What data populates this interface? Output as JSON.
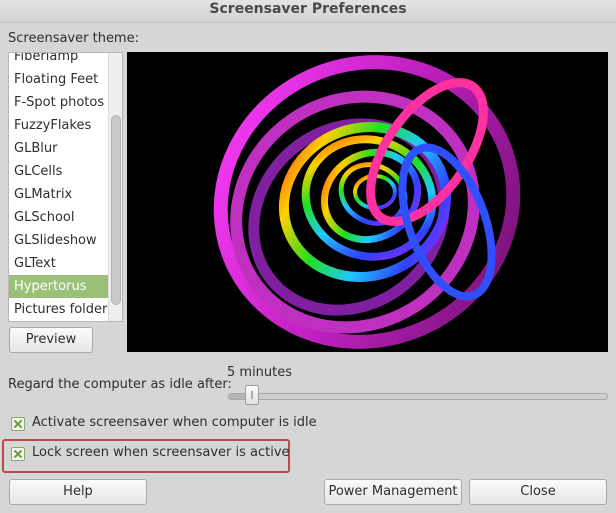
{
  "window": {
    "title": "Screensaver Preferences"
  },
  "theme": {
    "label": "Screensaver theme:",
    "items": [
      {
        "label": "Fiberlamp",
        "selected": false
      },
      {
        "label": "Floating Feet",
        "selected": false
      },
      {
        "label": "F-Spot photos",
        "selected": false
      },
      {
        "label": "FuzzyFlakes",
        "selected": false
      },
      {
        "label": "GLBlur",
        "selected": false
      },
      {
        "label": "GLCells",
        "selected": false
      },
      {
        "label": "GLMatrix",
        "selected": false
      },
      {
        "label": "GLSchool",
        "selected": false
      },
      {
        "label": "GLSlideshow",
        "selected": false
      },
      {
        "label": "GLText",
        "selected": false
      },
      {
        "label": "Hypertorus",
        "selected": true
      },
      {
        "label": "Pictures folder",
        "selected": false
      }
    ],
    "preview_button": "Preview"
  },
  "idle": {
    "label": "Regard the computer as idle after:",
    "value_text": "5 minutes",
    "slider_fraction": 0.06
  },
  "options": {
    "activate": {
      "label": "Activate screensaver when computer is idle",
      "checked": true
    },
    "lock": {
      "label": "Lock screen when screensaver is active",
      "checked": true
    }
  },
  "buttons": {
    "help": "Help",
    "power": "Power Management",
    "close": "Close"
  },
  "colors": {
    "selection": "#9cc07a",
    "highlight_border": "#c0474b",
    "checkbox_check": "#6d9a3f"
  }
}
